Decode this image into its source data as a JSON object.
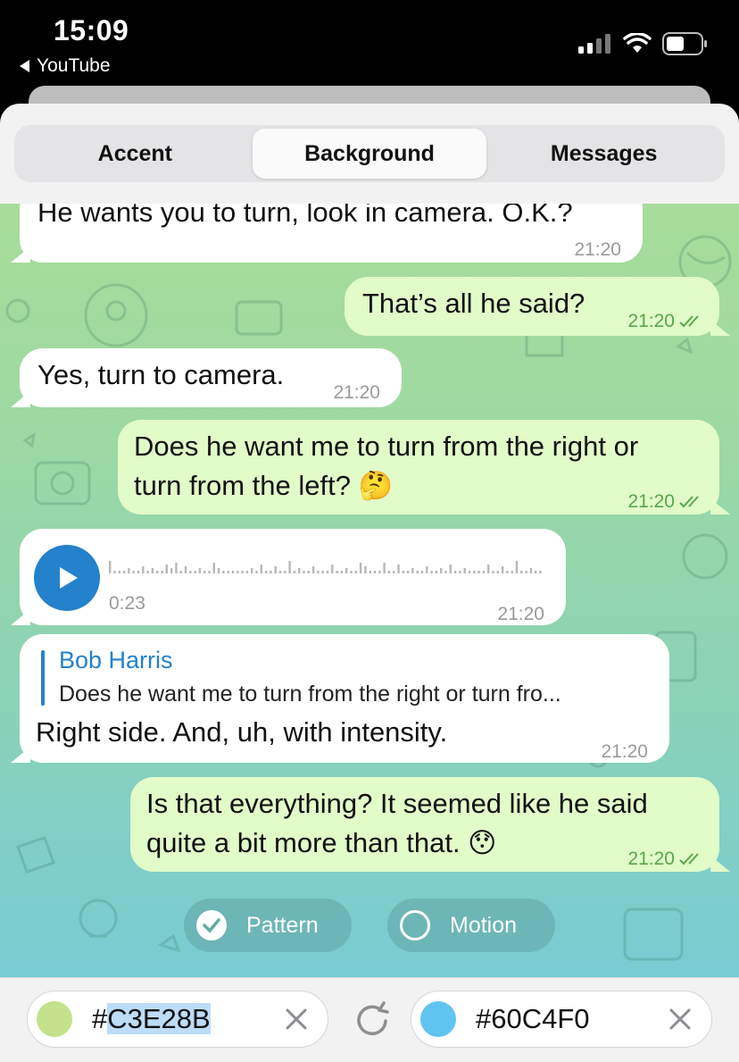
{
  "status_bar": {
    "time": "15:09",
    "back_app": "YouTube"
  },
  "tabs": [
    {
      "label": "Accent",
      "active": false
    },
    {
      "label": "Background",
      "active": true
    },
    {
      "label": "Messages",
      "active": false
    }
  ],
  "messages": [
    {
      "direction": "in",
      "text": "He wants you to turn, look in camera. O.K.?",
      "time": "21:20"
    },
    {
      "direction": "out",
      "text": "That’s all he said?",
      "time": "21:20",
      "read": true
    },
    {
      "direction": "in",
      "text": "Yes, turn to camera.",
      "time": "21:20"
    },
    {
      "direction": "out",
      "text_line1": "Does he want me to turn from the right or",
      "text_line2": "turn from the left? 🤔",
      "time": "21:20",
      "read": true
    },
    {
      "direction": "in",
      "type": "voice",
      "duration": "0:23",
      "time": "21:20"
    },
    {
      "direction": "in",
      "reply_name": "Bob Harris",
      "reply_text": "Does he want me to turn from the right or turn fro...",
      "text": "Right side. And, uh, with intensity.",
      "time": "21:20"
    },
    {
      "direction": "out",
      "text_line1": "Is that everything? It seemed like he said",
      "text_line2": "quite a bit more than that. 😯",
      "time": "21:20",
      "read": true
    }
  ],
  "toggles": {
    "pattern": {
      "label": "Pattern",
      "checked": true
    },
    "motion": {
      "label": "Motion",
      "checked": false
    }
  },
  "colors": {
    "first": {
      "hash": "#",
      "value": "C3E28B",
      "swatch": "#C3E28B"
    },
    "second": {
      "value": "#60C4F0",
      "swatch": "#60C4F0"
    }
  },
  "accent": "#2481CC"
}
